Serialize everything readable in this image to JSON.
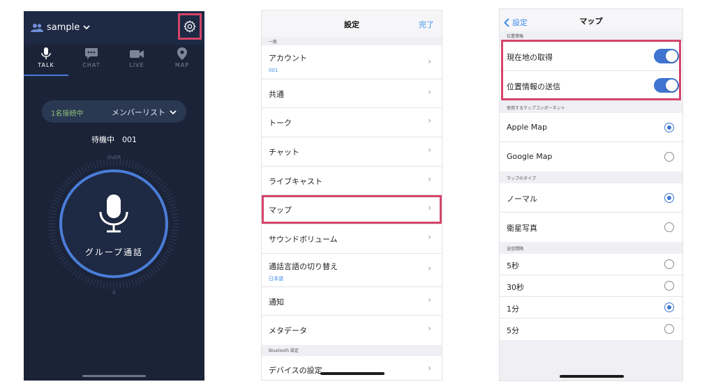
{
  "talk": {
    "group_name": "sample",
    "tabs": [
      "TALK",
      "CHAT",
      "LIVE",
      "MAP"
    ],
    "connection_status": "1名接続中",
    "member_list": "メンバーリスト",
    "waiting": "待機中　001",
    "over_label": "OVER",
    "zero_label": "0",
    "mic_label": "グループ通話",
    "colors": {
      "background": "#1a2338",
      "accent": "#4a7dd8",
      "status_green": "#8ec07a",
      "highlight": "#d4456b"
    }
  },
  "settings": {
    "title": "設定",
    "done": "完了",
    "section_general": "一般",
    "items": [
      {
        "label": "アカウント",
        "sub": "001"
      },
      {
        "label": "共通"
      },
      {
        "label": "トーク"
      },
      {
        "label": "チャット"
      },
      {
        "label": "ライブキャスト"
      },
      {
        "label": "マップ"
      },
      {
        "label": "サウンドボリューム"
      },
      {
        "label": "通話言語の切り替え",
        "sub": "日本語"
      },
      {
        "label": "通知"
      },
      {
        "label": "メタデータ"
      }
    ],
    "section_bluetooth": "Bluetooth 設定",
    "bt_items": [
      {
        "label": "デバイスの設定"
      }
    ]
  },
  "map": {
    "back": "設定",
    "title": "マップ",
    "section_location": "位置情報",
    "toggles": [
      {
        "label": "現在地の取得",
        "on": true
      },
      {
        "label": "位置情報の送信",
        "on": true
      }
    ],
    "section_component": "使用するマップコンポーネント",
    "components": [
      {
        "label": "Apple Map",
        "selected": true
      },
      {
        "label": "Google Map",
        "selected": false
      }
    ],
    "section_type": "マップのタイプ",
    "types": [
      {
        "label": "ノーマル",
        "selected": true
      },
      {
        "label": "衛星写真",
        "selected": false
      }
    ],
    "section_interval": "送信間隔",
    "intervals": [
      {
        "label": "5秒",
        "selected": false
      },
      {
        "label": "30秒",
        "selected": false
      },
      {
        "label": "1分",
        "selected": true
      },
      {
        "label": "5分",
        "selected": false
      }
    ]
  }
}
